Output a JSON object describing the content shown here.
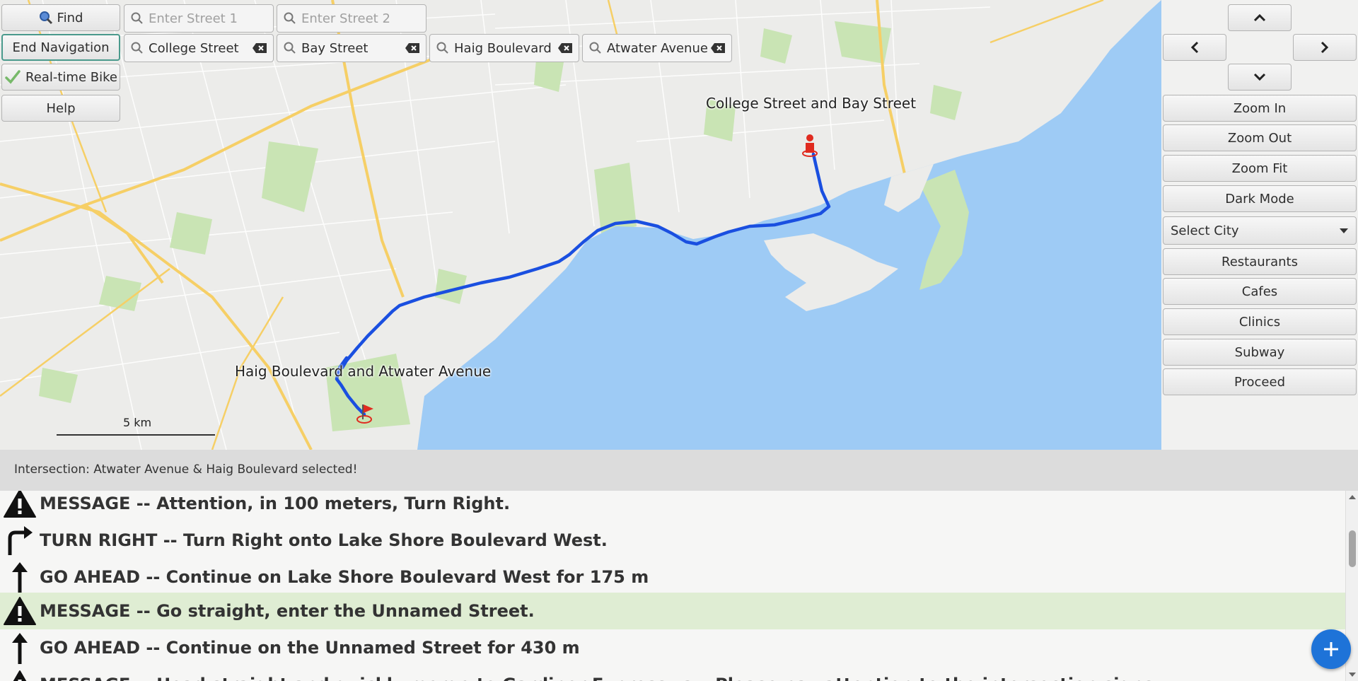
{
  "toolbar": {
    "find_label": "Find",
    "end_navigation_label": "End Navigation",
    "realtime_bike_label": "Real-time Bike",
    "help_label": "Help",
    "street1_placeholder": "Enter Street 1",
    "street2_placeholder": "Enter Street 2",
    "route_fields": [
      "College Street",
      "Bay Street",
      "Haig Boulevard",
      "Atwater Avenue"
    ]
  },
  "map": {
    "start_label": "College Street and Bay Street",
    "end_label": "Haig Boulevard and Atwater Avenue",
    "scale_label": "5 km",
    "colors": {
      "water": "#9ecbf5",
      "land": "#ececea",
      "park": "#c9e4b4",
      "highway": "#f6cf66",
      "route": "#1a4fe0",
      "marker": "#e02b20"
    }
  },
  "right_panel": {
    "nav_icons": [
      "chevron-up-icon",
      "chevron-left-icon",
      "chevron-right-icon",
      "chevron-down-icon"
    ],
    "zoom_in": "Zoom In",
    "zoom_out": "Zoom Out",
    "zoom_fit": "Zoom Fit",
    "dark_mode": "Dark Mode",
    "select_city": "Select City",
    "restaurants": "Restaurants",
    "cafes": "Cafes",
    "clinics": "Clinics",
    "subway": "Subway",
    "proceed": "Proceed"
  },
  "status": "Intersection: Atwater Avenue & Haig Boulevard selected!",
  "directions": [
    {
      "icon": "warning-icon",
      "text": "MESSAGE -- Attention, in 100 meters, Turn Right.",
      "highlight": false
    },
    {
      "icon": "turn-right-icon",
      "text": "TURN RIGHT -- Turn Right onto Lake Shore Boulevard West.",
      "highlight": false
    },
    {
      "icon": "arrow-up-icon",
      "text": "GO AHEAD -- Continue on Lake Shore Boulevard West for 175 m",
      "highlight": false
    },
    {
      "icon": "warning-icon",
      "text": "MESSAGE -- Go straight, enter the Unnamed Street.",
      "highlight": true
    },
    {
      "icon": "arrow-up-icon",
      "text": "GO AHEAD -- Continue on the Unnamed Street for 430 m",
      "highlight": false
    },
    {
      "icon": "warning-icon",
      "text": "MESSAGE -- Head straight and quickly merge to Gardiner Expressway. Please pay attention to the intersection signs.",
      "highlight": false
    }
  ]
}
